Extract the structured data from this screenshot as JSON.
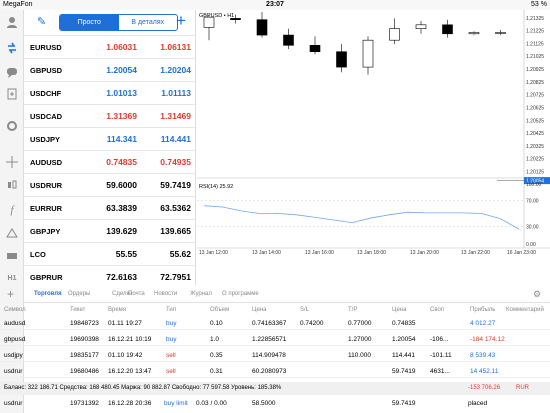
{
  "status_bar": {
    "carrier": "MegaFon",
    "time": "23:07",
    "battery": "53 %"
  },
  "sidebar": {
    "icons": [
      "person-icon",
      "quotes-icon",
      "chat-icon",
      "news-icon",
      "settings-icon",
      "crosshair-icon",
      "candles-icon",
      "function-icon",
      "objects-icon",
      "timeframe-icon"
    ],
    "timeframe_label": "H1"
  },
  "quotes": {
    "edit_label": "✎",
    "tab_simple": "Просто",
    "tab_detailed": "В деталях",
    "add_label": "+",
    "rows": [
      {
        "symbol": "EURUSD",
        "bid": "1.06031",
        "ask": "1.06131",
        "dir": "dn"
      },
      {
        "symbol": "GBPUSD",
        "bid": "1.20054",
        "ask": "1.20204",
        "dir": "up"
      },
      {
        "symbol": "USDCHF",
        "bid": "1.01013",
        "ask": "1.01113",
        "dir": "up"
      },
      {
        "symbol": "USDCAD",
        "bid": "1.31369",
        "ask": "1.31469",
        "dir": "dn"
      },
      {
        "symbol": "USDJPY",
        "bid": "114.341",
        "ask": "114.441",
        "dir": "up"
      },
      {
        "symbol": "AUDUSD",
        "bid": "0.74835",
        "ask": "0.74935",
        "dir": "dn"
      },
      {
        "symbol": "USDRUR",
        "bid": "59.6000",
        "ask": "59.7419",
        "dir": "nt"
      },
      {
        "symbol": "EURRUR",
        "bid": "63.3839",
        "ask": "63.5362",
        "dir": "nt"
      },
      {
        "symbol": "GBPJPY",
        "bid": "139.629",
        "ask": "139.665",
        "dir": "nt"
      },
      {
        "symbol": "LCO",
        "bid": "55.55",
        "ask": "55.62",
        "dir": "nt"
      },
      {
        "symbol": "GBPRUR",
        "bid": "72.6163",
        "ask": "72.7951",
        "dir": "nt"
      }
    ]
  },
  "chart": {
    "title": "GBPUSD • H1",
    "price_labels": [
      "1.21325",
      "1.21225",
      "1.21125",
      "1.21025",
      "1.20925",
      "1.20825",
      "1.20725",
      "1.20625",
      "1.20525",
      "1.20425",
      "1.20325",
      "1.20225",
      "1.20125"
    ],
    "current_price": "1.20054",
    "rsi_title": "RSI(14) 25.92",
    "rsi_levels": [
      "100.00",
      "70.00",
      "30.00",
      "0.00"
    ],
    "time_labels": [
      "13 Jan 12:00",
      "13 Jan 14:00",
      "13 Jan 16:00",
      "13 Jan 18:00",
      "13 Jan 20:00",
      "13 Jan 22:00",
      "16 Jan 23:00"
    ]
  },
  "chart_data": [
    {
      "type": "candlestick",
      "title": "GBPUSD • H1",
      "ylim": [
        1.2009,
        1.2137
      ],
      "candles": [
        {
          "o": 1.2125,
          "h": 1.2135,
          "l": 1.2115,
          "c": 1.2133
        },
        {
          "o": 1.2132,
          "h": 1.2135,
          "l": 1.2128,
          "c": 1.2131
        },
        {
          "o": 1.2131,
          "h": 1.2137,
          "l": 1.2117,
          "c": 1.2119
        },
        {
          "o": 1.2119,
          "h": 1.2124,
          "l": 1.2108,
          "c": 1.2111
        },
        {
          "o": 1.2111,
          "h": 1.2118,
          "l": 1.2104,
          "c": 1.2106
        },
        {
          "o": 1.2106,
          "h": 1.2112,
          "l": 1.209,
          "c": 1.2094
        },
        {
          "o": 1.2094,
          "h": 1.2118,
          "l": 1.2088,
          "c": 1.2115
        },
        {
          "o": 1.2115,
          "h": 1.2132,
          "l": 1.2112,
          "c": 1.2124
        },
        {
          "o": 1.2124,
          "h": 1.213,
          "l": 1.212,
          "c": 1.2127
        },
        {
          "o": 1.2127,
          "h": 1.2131,
          "l": 1.2117,
          "c": 1.212
        },
        {
          "o": 1.212,
          "h": 1.2122,
          "l": 1.2119,
          "c": 1.2121
        },
        {
          "o": 1.2121,
          "h": 1.2123,
          "l": 1.2119,
          "c": 1.2121
        }
      ]
    },
    {
      "type": "line",
      "title": "RSI(14) 25.92",
      "ylim": [
        0,
        100
      ],
      "series": [
        {
          "values": [
            62,
            60,
            54,
            50,
            50,
            48,
            44,
            40,
            36,
            43,
            48,
            52,
            51,
            51,
            51,
            50,
            42,
            25.92
          ]
        }
      ]
    }
  ],
  "terminal": {
    "tabs": [
      "Торговля",
      "Ордеры",
      "Сделки",
      "Почта",
      "Новости",
      "Журнал",
      "О программе"
    ],
    "headers": [
      "Символ",
      "Тикет",
      "Время",
      "Тип",
      "Объем",
      "Цена",
      "S/L",
      "T/P",
      "Цена",
      "Своп",
      "Прибыль",
      "Комментарий"
    ],
    "positions": [
      {
        "symbol": "audusd",
        "ticket": "19848723",
        "time": "01.11 19:27",
        "type": "buy",
        "volume": "0.10",
        "price": "0.74163367",
        "sl": "0.74200",
        "tp": "0.77000",
        "cur": "0.74835",
        "swap": "",
        "profit": "4 012.27",
        "ptype": "buy"
      },
      {
        "symbol": "gbpusd",
        "ticket": "19690398",
        "time": "16.12.21 10:19",
        "type": "buy",
        "volume": "1.0",
        "price": "1.22856571",
        "sl": "",
        "tp": "1.27000",
        "cur": "1.20054",
        "swap": "-106...",
        "profit": "-184 174.12",
        "ptype": "sell"
      },
      {
        "symbol": "usdjpy",
        "ticket": "19835177",
        "time": "01.10 19:42",
        "type": "sell",
        "volume": "0.35",
        "price": "114.909478",
        "sl": "",
        "tp": "110.000",
        "cur": "114.441",
        "swap": "-101.11",
        "profit": "8 539.43",
        "ptype": "buy"
      },
      {
        "symbol": "usdrur",
        "ticket": "19680486",
        "time": "16.12.20 13:47",
        "type": "sell",
        "volume": "0.31",
        "price": "60.2080973",
        "sl": "",
        "tp": "",
        "cur": "59.7419",
        "swap": "4631...",
        "profit": "14 452.11",
        "ptype": "buy"
      }
    ],
    "summary": {
      "text": "Баланс: 322 186.71 Средства: 168 480.45 Маржа: 90 882.87 Свободно: 77 597.58 Уровень: 185.38%",
      "profit": "-153 706.26",
      "currency": "RUR"
    },
    "order": {
      "symbol": "usdrur",
      "ticket": "19731392",
      "time": "16.12.28 20:36",
      "type": "buy limit",
      "volume": "0.03 / 0.00",
      "price": "58.5000",
      "cur": "59.7419",
      "state": "placed"
    }
  }
}
